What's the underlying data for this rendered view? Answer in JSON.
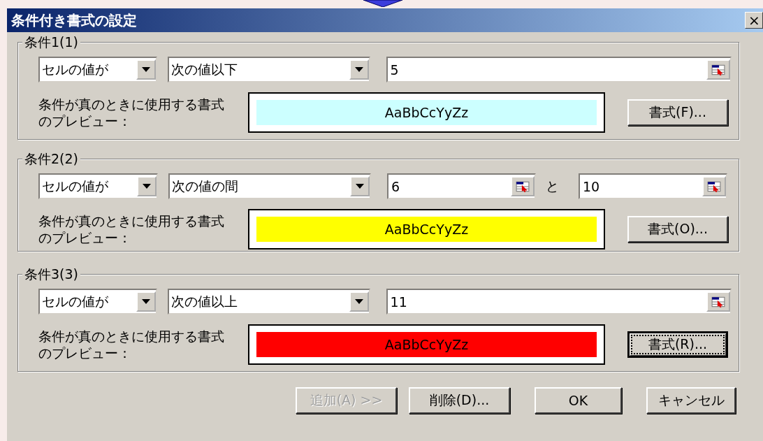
{
  "window": {
    "title": "条件付き書式の設定",
    "close": "×"
  },
  "conditions": [
    {
      "legend": "条件1(1)",
      "field_select": "セルの値が",
      "operator": "次の値以下",
      "values": [
        "5"
      ],
      "preview_label": "条件が真のときに使用する書式のプレビュー：",
      "preview_text": "AaBbCcYyZz",
      "color": "#ccffff",
      "format_button": "書式(F)...",
      "focused": false
    },
    {
      "legend": "条件2(2)",
      "field_select": "セルの値が",
      "operator": "次の値の間",
      "values": [
        "6",
        "10"
      ],
      "joiner": "と",
      "preview_label": "条件が真のときに使用する書式のプレビュー：",
      "preview_text": "AaBbCcYyZz",
      "color": "#ffff00",
      "format_button": "書式(O)...",
      "focused": false
    },
    {
      "legend": "条件3(3)",
      "field_select": "セルの値が",
      "operator": "次の値以上",
      "values": [
        "11"
      ],
      "preview_label": "条件が真のときに使用する書式のプレビュー：",
      "preview_text": "AaBbCcYyZz",
      "color": "#ff0000",
      "format_button": "書式(R)...",
      "focused": true
    }
  ],
  "buttons": [
    {
      "label": "追加(A) >>",
      "disabled": true
    },
    {
      "label": "削除(D)...",
      "disabled": false
    },
    {
      "label": "OK",
      "disabled": false
    },
    {
      "label": "キャンセル",
      "disabled": false
    }
  ]
}
